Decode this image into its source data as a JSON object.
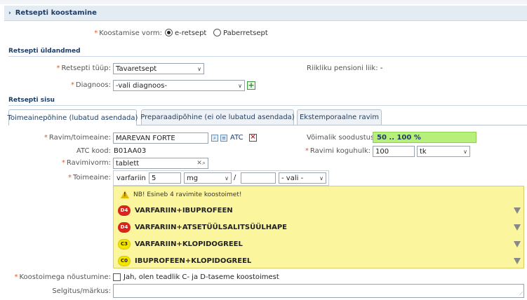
{
  "header": {
    "title": "Retsepti koostamine"
  },
  "form_type": {
    "label": "Koostamise vorm:",
    "options": [
      {
        "label": "e-retsept",
        "selected": true
      },
      {
        "label": "Paberretsept",
        "selected": false
      }
    ]
  },
  "general": {
    "section_title": "Retsepti üldandmed",
    "type_label": "Retsepti tüüp:",
    "type_value": "Tavaretsept",
    "pension_label": "Riikliku pensioni liik:",
    "pension_value": "-",
    "diagnosis_label": "Diagnoos:",
    "diagnosis_value": "-vali diagnoos-"
  },
  "content": {
    "section_title": "Retsepti sisu",
    "tabs": [
      {
        "label": "Toimeainepõhine (lubatud asendada)",
        "active": true
      },
      {
        "label": "Preparaadipõhine (ei ole lubatud asendada)",
        "active": false
      },
      {
        "label": "Ekstemporaalne ravim",
        "active": false
      }
    ]
  },
  "drug": {
    "drug_label": "Ravim/toimeaine:",
    "drug_value": "MAREVAN FORTE",
    "atc_link": "ATC",
    "atc_label": "ATC kood:",
    "atc_value": "B01AA03",
    "form_label": "Ravimivorm:",
    "form_value": "tablett",
    "discount_label": "Võimalik soodustus:",
    "discount_value": "50 .. 100 %",
    "quantity_label": "Ravimi koguhulk:",
    "quantity_value": "100",
    "quantity_unit": "tk",
    "substance_label": "Toimeaine:",
    "substance_name": "varfariin",
    "dose_value": "5",
    "dose_unit": "mg",
    "slash": "/",
    "per_value": "",
    "per_unit": "- vali -"
  },
  "interactions": {
    "warning": "NB! Esineb 4 ravimite koostoimet!",
    "items": [
      {
        "level": "D4",
        "name": "VARFARIIN+IBUPROFEEN",
        "color": "#d9241c"
      },
      {
        "level": "D4",
        "name": "VARFARIIN+ATSETÜÜLSALITSÜÜLHAPE",
        "color": "#d9241c"
      },
      {
        "level": "C3",
        "name": "VARFARIIN+KLOPIDOGREEL",
        "color": "#f5e400"
      },
      {
        "level": "C0",
        "name": "IBUPROFEEN+KLOPIDOGREEL",
        "color": "#f5e400"
      }
    ]
  },
  "consent": {
    "label": "Koostoimega nõustumine:",
    "checkbox_text": "Jah, olen teadlik C- ja D-taseme koostoimest"
  },
  "notes": {
    "label": "Selgitus/märkus:",
    "value": ""
  }
}
